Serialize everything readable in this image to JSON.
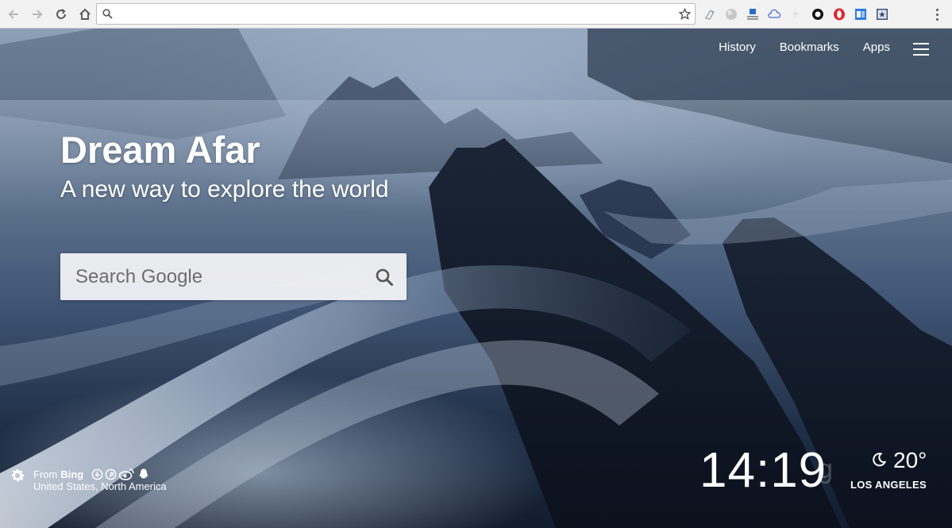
{
  "browser": {
    "omnibox_value": "",
    "extensions": [
      "tagger-icon",
      "globe-icon",
      "download-icon",
      "cloud-icon",
      "bolt-icon",
      "ring-icon",
      "opera-icon",
      "window-icon",
      "star-square-icon"
    ]
  },
  "nav": {
    "links": [
      "History",
      "Bookmarks",
      "Apps"
    ]
  },
  "hero": {
    "title": "Dream Afar",
    "subtitle": "A new way to explore the world"
  },
  "search": {
    "placeholder": "Search Google"
  },
  "credit": {
    "from_label": "From",
    "source": "Bing",
    "location": "United States, North America",
    "share_icons": [
      "download-circle-icon",
      "pinterest-icon",
      "weibo-icon",
      "qq-icon"
    ]
  },
  "clock": {
    "time": "14:19",
    "ghost": "g"
  },
  "weather": {
    "temp": "20°",
    "city": "LOS ANGELES",
    "condition_icon": "moon-icon"
  },
  "colors": {
    "text": "#ffffff",
    "search_bg": "#f0f0f4",
    "toolbar_bg": "#f2f2f2"
  }
}
